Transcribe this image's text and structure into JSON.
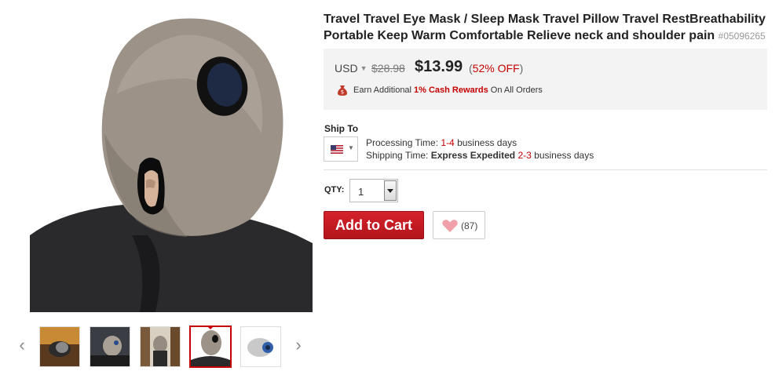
{
  "product": {
    "title": "Travel Travel Eye Mask / Sleep Mask Travel Pillow Travel RestBreathability Portable Keep Warm Comfortable Relieve neck and shoulder pain",
    "sku": "#05096265"
  },
  "price": {
    "currency": "USD",
    "old": "$28.98",
    "new": "$13.99",
    "discount_open": "(",
    "discount_pct": "52% OFF",
    "discount_close": ")"
  },
  "rewards": {
    "prefix": "Earn Additional",
    "highlight": "1% Cash Rewards",
    "suffix": "On All Orders"
  },
  "shipping": {
    "label": "Ship To",
    "processing_label": "Processing Time:",
    "processing_range": "1-4",
    "processing_unit": "business days",
    "shipping_label": "Shipping Time:",
    "shipping_method": "Express Expedited",
    "shipping_range": "2-3",
    "shipping_unit": "business days"
  },
  "qty": {
    "label": "QTY:",
    "value": "1"
  },
  "actions": {
    "add_to_cart": "Add to Cart",
    "wishlist_count": "(87)"
  },
  "thumbnails": [
    {
      "name": "thumb-1"
    },
    {
      "name": "thumb-2"
    },
    {
      "name": "thumb-3"
    },
    {
      "name": "thumb-4",
      "active": true
    },
    {
      "name": "thumb-5"
    }
  ],
  "icons": {
    "prev": "chevron-left-icon",
    "next": "chevron-right-icon",
    "bag": "money-bag-icon",
    "flag": "us-flag-icon",
    "heart": "heart-icon"
  },
  "colors": {
    "accent": "#c40000",
    "cart_button": "#c8161e",
    "price_bg": "#f3f3f3"
  }
}
